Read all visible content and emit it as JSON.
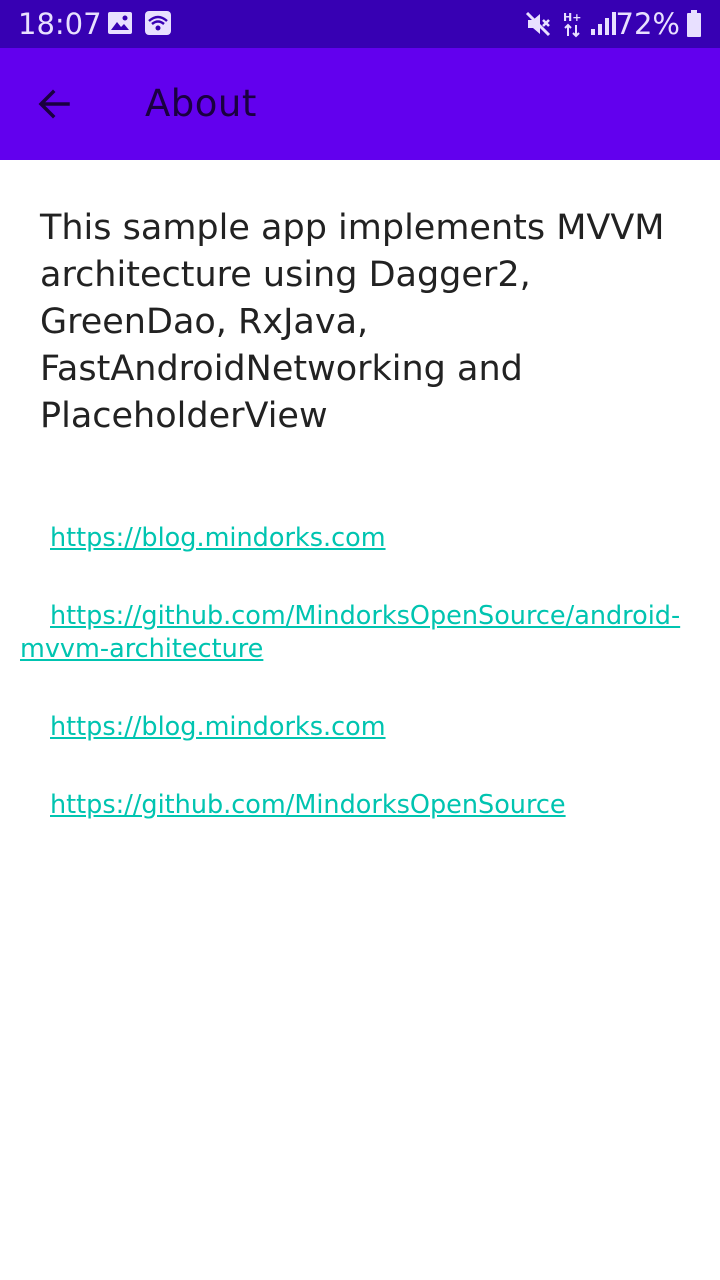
{
  "status_bar": {
    "time": "18:07",
    "battery": "72%",
    "icons": [
      "image-icon",
      "wifi-hotspot-icon",
      "mute-icon",
      "network-hplus-icon",
      "signal-icon",
      "battery-icon"
    ]
  },
  "app_bar": {
    "back_icon": "arrow-back-icon",
    "title": "About"
  },
  "content": {
    "description": "This sample app implements MVVM architecture using Dagger2, GreenDao, RxJava, FastAndroidNetworking and PlaceholderView",
    "links": [
      "https://blog.mindorks.com",
      "https://github.com/MindorksOpenSource/android-mvvm-architecture",
      "https://blog.mindorks.com",
      "https://github.com/MindorksOpenSource"
    ]
  },
  "colors": {
    "status_bar": "#3700B3",
    "app_bar": "#6200EE",
    "link": "#00C4B0",
    "text": "#222222"
  }
}
